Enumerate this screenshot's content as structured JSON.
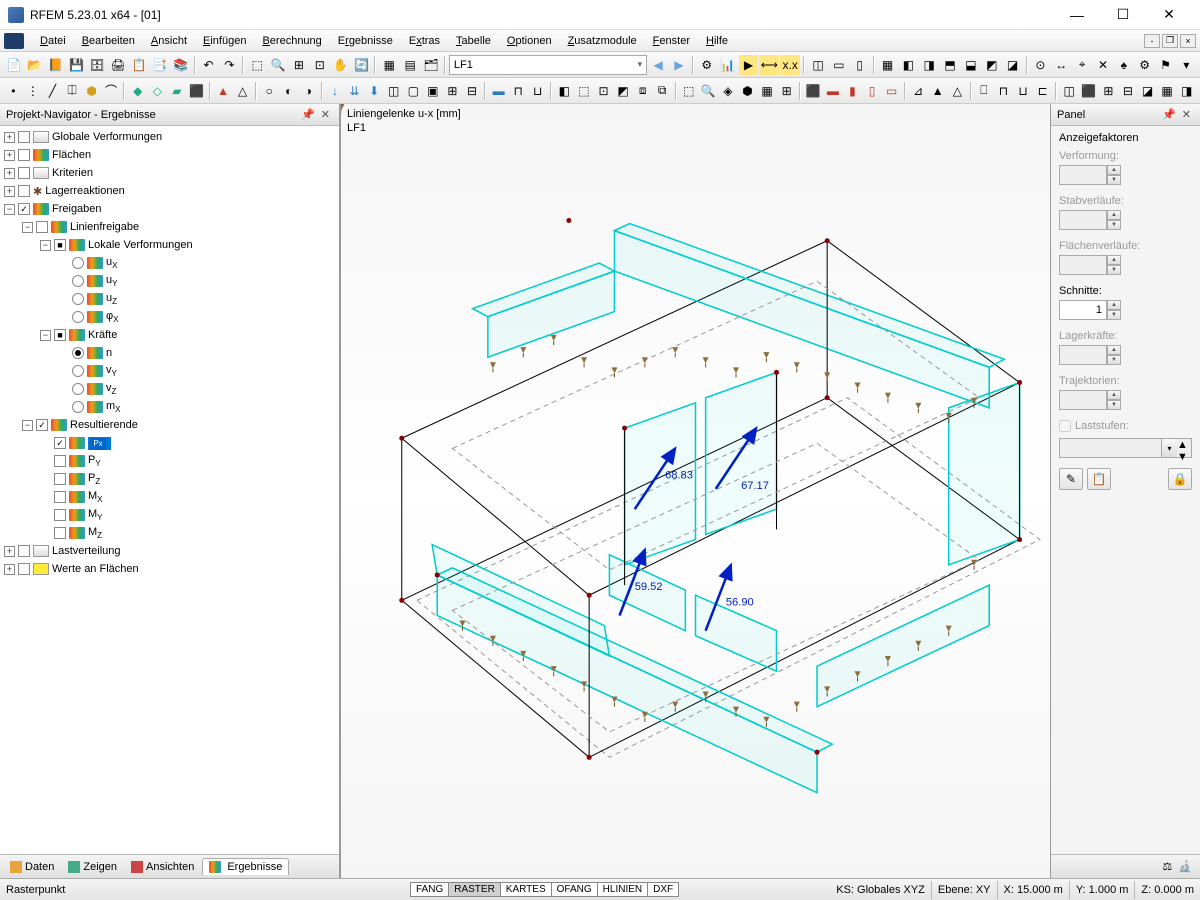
{
  "title": "RFEM 5.23.01 x64 - [01]",
  "menus": [
    "Datei",
    "Bearbeiten",
    "Ansicht",
    "Einfügen",
    "Berechnung",
    "Ergebnisse",
    "Extras",
    "Tabelle",
    "Optionen",
    "Zusatzmodule",
    "Fenster",
    "Hilfe"
  ],
  "loadcase": "LF1",
  "navigator": {
    "title": "Projekt-Navigator - Ergebnisse",
    "tabs": [
      "Daten",
      "Zeigen",
      "Ansichten",
      "Ergebnisse"
    ],
    "tree": {
      "globale": "Globale Verformungen",
      "flaechen": "Flächen",
      "kriterien": "Kriterien",
      "lager": "Lagerreaktionen",
      "freigaben": "Freigaben",
      "linienfreigabe": "Linienfreigabe",
      "lokale": "Lokale Verformungen",
      "ux": "u<sub>X</sub>",
      "uy": "u<sub>Y</sub>",
      "uz": "u<sub>Z</sub>",
      "phix": "φ<sub>X</sub>",
      "kraefte": "Kräfte",
      "n": "n",
      "vy": "v<sub>Y</sub>",
      "vz": "v<sub>Z</sub>",
      "mx": "m<sub>X</sub>",
      "resultierende": "Resultierende",
      "px_label": "P",
      "py": "P<sub>Y</sub>",
      "pz": "P<sub>Z</sub>",
      "Mx": "M<sub>X</sub>",
      "My": "M<sub>Y</sub>",
      "Mz": "M<sub>Z</sub>",
      "lastverteilung": "Lastverteilung",
      "werte": "Werte an Flächen"
    }
  },
  "viewport": {
    "label1": "Liniengelenke u-x [mm]",
    "label2": "LF1",
    "values": {
      "a": "68.83",
      "b": "67.17",
      "c": "59.52",
      "d": "56.90"
    }
  },
  "panel": {
    "title": "Panel",
    "group": "Anzeigefaktoren",
    "fields": {
      "verformung": "Verformung:",
      "stab": "Stabverläufe:",
      "flaechen": "Flächenverläufe:",
      "schnitte": "Schnitte:",
      "schnitte_val": "1",
      "lagerkraefte": "Lagerkräfte:",
      "trajektorien": "Trajektorien:",
      "laststufen": "Laststufen:"
    }
  },
  "status": {
    "left": "Rasterpunkt",
    "tabs": [
      "FANG",
      "RASTER",
      "KARTES",
      "OFANG",
      "HLINIEN",
      "DXF"
    ],
    "ks": "KS: Globales XYZ",
    "ebene": "Ebene: XY",
    "x": "X: 15.000 m",
    "y": "Y: 1.000 m",
    "z": "Z: 0.000 m"
  }
}
